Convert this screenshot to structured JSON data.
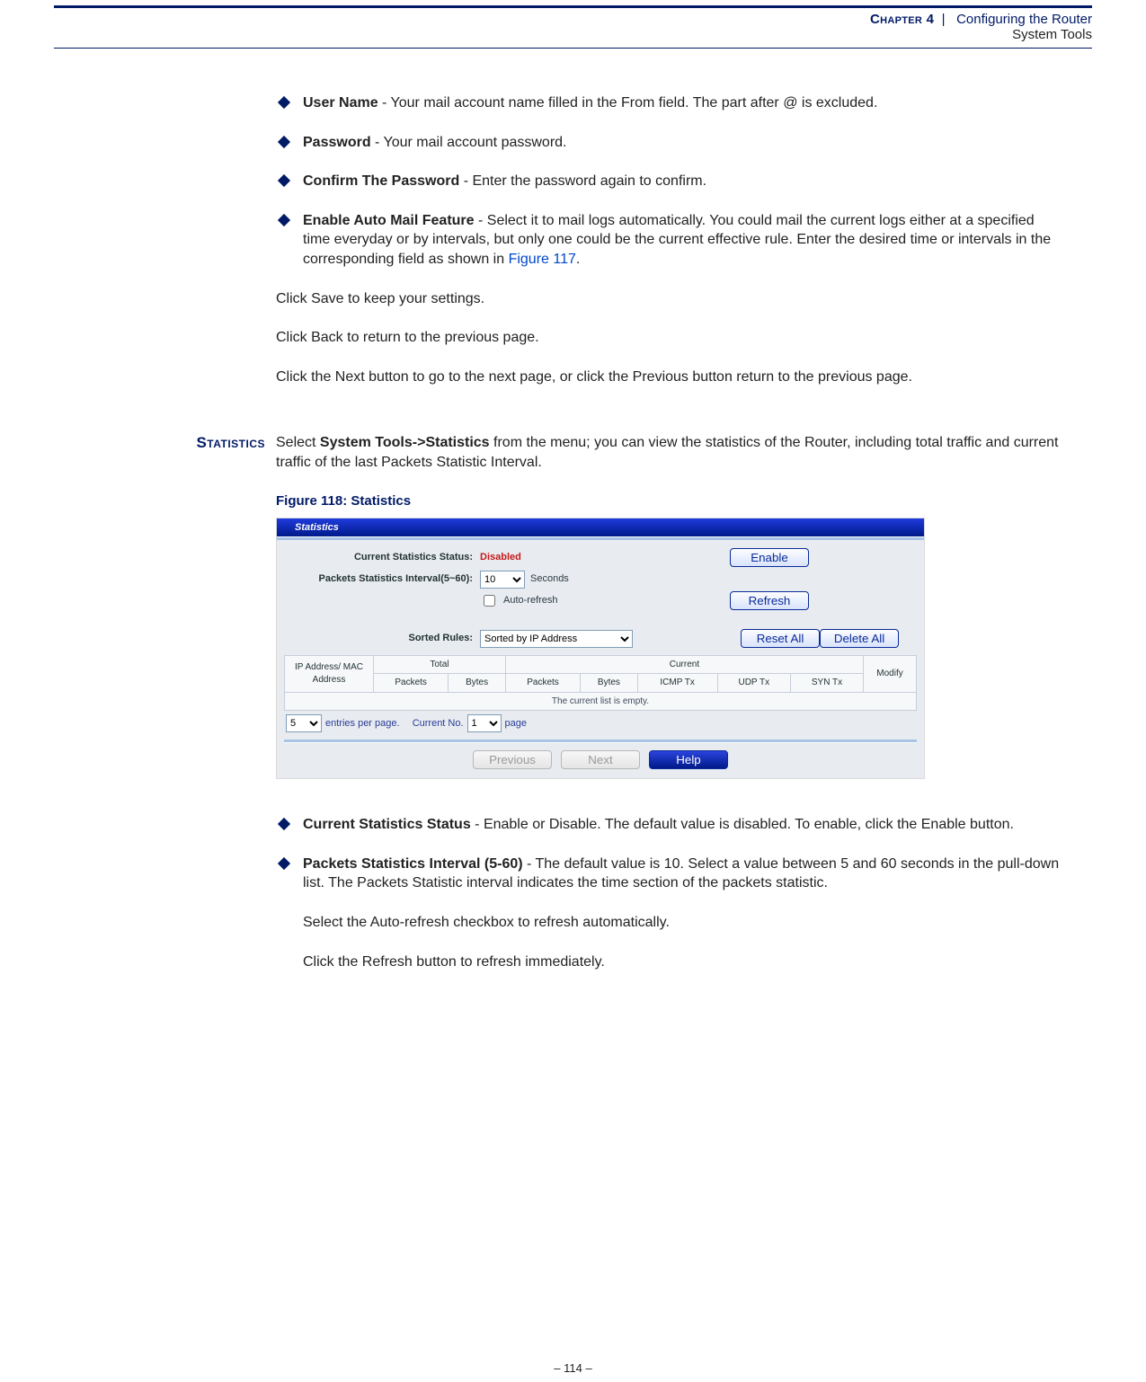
{
  "header": {
    "chapter_label": "Chapter 4",
    "separator": "|",
    "doc_title": "Configuring the Router",
    "subtitle": "System Tools"
  },
  "section_upper": {
    "bullets": [
      {
        "term": "User Name",
        "text": " - Your mail account name filled in the From field. The part after @ is excluded."
      },
      {
        "term": "Password",
        "text": " - Your mail account password."
      },
      {
        "term": "Confirm The Password",
        "text": " - Enter the password again to confirm."
      },
      {
        "term": "Enable Auto Mail Feature",
        "text": " - Select it to mail logs automatically. You could mail the current logs either at a specified time everyday or by intervals, but only one could be the current effective rule. Enter the desired time or intervals in the corresponding field as shown in ",
        "link": "Figure 117",
        "tail": "."
      }
    ],
    "paras": [
      "Click Save to keep your settings.",
      "Click Back to return to the previous page.",
      "Click the Next button to go to the next page, or click the Previous button return to the previous page."
    ]
  },
  "statistics": {
    "side_label": "Statistics",
    "intro_prefix": "Select ",
    "intro_bold": "System Tools->Statistics",
    "intro_suffix": " from the menu; you can view the statistics of the Router, including total traffic and current traffic of the last Packets Statistic Interval.",
    "figure_caption": "Figure 118:  Statistics"
  },
  "shot": {
    "title": "Statistics",
    "row_status_label": "Current Statistics Status:",
    "row_status_value": "Disabled",
    "btn_enable": "Enable",
    "row_interval_label": "Packets Statistics Interval(5~60):",
    "interval_value": "10",
    "interval_unit": "Seconds",
    "auto_refresh_label": "Auto-refresh",
    "btn_refresh": "Refresh",
    "row_sorted_label": "Sorted Rules:",
    "sorted_value": "Sorted by IP Address",
    "btn_reset": "Reset All",
    "btn_delete": "Delete All",
    "grid": {
      "col_ip": "IP Address/ MAC Address",
      "group_total": "Total",
      "group_current": "Current",
      "col_packets": "Packets",
      "col_bytes": "Bytes",
      "col_icmp": "ICMP Tx",
      "col_udp": "UDP Tx",
      "col_syn": "SYN Tx",
      "col_modify": "Modify",
      "empty_msg": "The current list is empty."
    },
    "pager": {
      "entries_value": "5",
      "entries_suffix": "entries per page.",
      "currno_prefix": "Current No.",
      "currno_value": "1",
      "currno_suffix": "page"
    },
    "btn_prev": "Previous",
    "btn_next": "Next",
    "btn_help": "Help"
  },
  "section_lower": {
    "bullets": [
      {
        "term": "Current Statistics Status",
        "text": " - Enable or Disable. The default value is disabled. To enable, click the Enable button."
      },
      {
        "term": "Packets Statistics Interval (5-60)",
        "text": " - The default value is 10. Select a value between 5 and 60 seconds in the pull-down list. The Packets Statistic interval indicates the time section of the packets statistic.",
        "extras": [
          "Select the Auto-refresh checkbox to refresh automatically.",
          "Click the Refresh button to refresh immediately."
        ]
      }
    ]
  },
  "page_number": "–  114  –"
}
